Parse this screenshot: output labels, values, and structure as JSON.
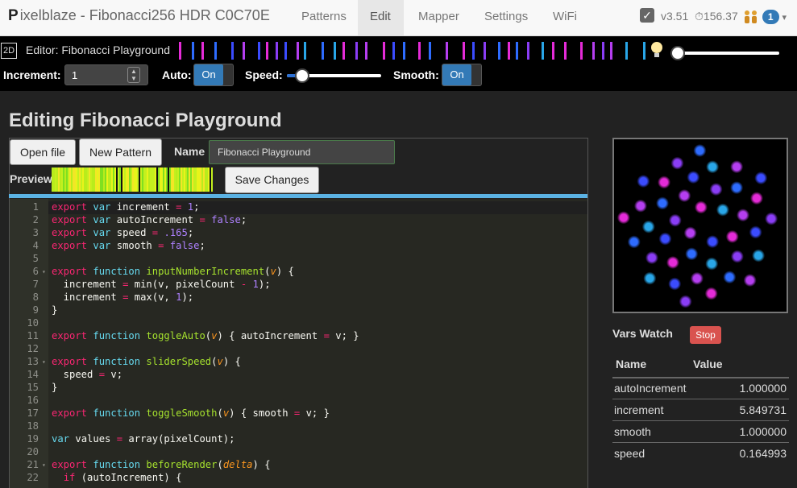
{
  "nav": {
    "brand_logo": "P",
    "brand_title": "ixelblaze - Fibonacci256 HDR C0C70E",
    "items": [
      "Patterns",
      "Edit",
      "Mapper",
      "Settings",
      "WiFi"
    ],
    "active": "Edit",
    "version": "v3.51",
    "fps": "⏱156.37",
    "connections": "1",
    "caret": "▾",
    "check": "✓"
  },
  "editor_bar": {
    "mode": "2D",
    "title": "Editor: Fibonacci Playground",
    "brightness": 0.07,
    "controls": {
      "increment_label": "Increment:",
      "increment_value": "1",
      "spin_up": "▲",
      "spin_down": "▼",
      "auto_label": "Auto:",
      "auto_state": "On",
      "speed_label": "Speed:",
      "speed_value": 0.165,
      "smooth_label": "Smooth:",
      "smooth_state": "On"
    }
  },
  "page": {
    "heading": "Editing Fibonacci Playground",
    "open_file": "Open file",
    "new_pattern": "New Pattern",
    "name_label": "Name",
    "name_value": "Fibonacci Playground",
    "preview_label": "Preview",
    "save_changes": "Save Changes"
  },
  "code": {
    "line_numbers": [
      "1",
      "2",
      "3",
      "4",
      "5",
      "6",
      "7",
      "8",
      "9",
      "10",
      "11",
      "12",
      "13",
      "14",
      "15",
      "16",
      "17",
      "18",
      "19",
      "20",
      "21",
      "22"
    ],
    "fold_marker": "▾",
    "lines": [
      [
        [
          "k",
          "export"
        ],
        [
          "t",
          " "
        ],
        [
          "s",
          "var"
        ],
        [
          "t",
          " increment "
        ],
        [
          "o",
          "="
        ],
        [
          "t",
          " "
        ],
        [
          "n",
          "1"
        ],
        [
          "t",
          ";"
        ]
      ],
      [
        [
          "k",
          "export"
        ],
        [
          "t",
          " "
        ],
        [
          "s",
          "var"
        ],
        [
          "t",
          " autoIncrement "
        ],
        [
          "o",
          "="
        ],
        [
          "t",
          " "
        ],
        [
          "n",
          "false"
        ],
        [
          "t",
          ";"
        ]
      ],
      [
        [
          "k",
          "export"
        ],
        [
          "t",
          " "
        ],
        [
          "s",
          "var"
        ],
        [
          "t",
          " speed "
        ],
        [
          "o",
          "="
        ],
        [
          "t",
          " "
        ],
        [
          "n",
          ".165"
        ],
        [
          "t",
          ";"
        ]
      ],
      [
        [
          "k",
          "export"
        ],
        [
          "t",
          " "
        ],
        [
          "s",
          "var"
        ],
        [
          "t",
          " smooth "
        ],
        [
          "o",
          "="
        ],
        [
          "t",
          " "
        ],
        [
          "n",
          "false"
        ],
        [
          "t",
          ";"
        ]
      ],
      [],
      [
        [
          "k",
          "export"
        ],
        [
          "t",
          " "
        ],
        [
          "s",
          "function"
        ],
        [
          "t",
          " "
        ],
        [
          "f",
          "inputNumberIncrement"
        ],
        [
          "t",
          "("
        ],
        [
          "p",
          "v"
        ],
        [
          "t",
          ") {"
        ]
      ],
      [
        [
          "t",
          "  increment "
        ],
        [
          "o",
          "="
        ],
        [
          "t",
          " min(v, pixelCount "
        ],
        [
          "o",
          "-"
        ],
        [
          "t",
          " "
        ],
        [
          "n",
          "1"
        ],
        [
          "t",
          ");"
        ]
      ],
      [
        [
          "t",
          "  increment "
        ],
        [
          "o",
          "="
        ],
        [
          "t",
          " max(v, "
        ],
        [
          "n",
          "1"
        ],
        [
          "t",
          ");"
        ]
      ],
      [
        [
          "t",
          "}"
        ]
      ],
      [],
      [
        [
          "k",
          "export"
        ],
        [
          "t",
          " "
        ],
        [
          "s",
          "function"
        ],
        [
          "t",
          " "
        ],
        [
          "f",
          "toggleAuto"
        ],
        [
          "t",
          "("
        ],
        [
          "p",
          "v"
        ],
        [
          "t",
          ") { autoIncrement "
        ],
        [
          "o",
          "="
        ],
        [
          "t",
          " v; }"
        ]
      ],
      [],
      [
        [
          "k",
          "export"
        ],
        [
          "t",
          " "
        ],
        [
          "s",
          "function"
        ],
        [
          "t",
          " "
        ],
        [
          "f",
          "sliderSpeed"
        ],
        [
          "t",
          "("
        ],
        [
          "p",
          "v"
        ],
        [
          "t",
          ") {"
        ]
      ],
      [
        [
          "t",
          "  speed "
        ],
        [
          "o",
          "="
        ],
        [
          "t",
          " v;"
        ]
      ],
      [
        [
          "t",
          "}"
        ]
      ],
      [],
      [
        [
          "k",
          "export"
        ],
        [
          "t",
          " "
        ],
        [
          "s",
          "function"
        ],
        [
          "t",
          " "
        ],
        [
          "f",
          "toggleSmooth"
        ],
        [
          "t",
          "("
        ],
        [
          "p",
          "v"
        ],
        [
          "t",
          ") { smooth "
        ],
        [
          "o",
          "="
        ],
        [
          "t",
          " v; }"
        ]
      ],
      [],
      [
        [
          "s",
          "var"
        ],
        [
          "t",
          " values "
        ],
        [
          "o",
          "="
        ],
        [
          "t",
          " array(pixelCount);"
        ]
      ],
      [],
      [
        [
          "k",
          "export"
        ],
        [
          "t",
          " "
        ],
        [
          "s",
          "function"
        ],
        [
          "t",
          " "
        ],
        [
          "f",
          "beforeRender"
        ],
        [
          "t",
          "("
        ],
        [
          "p",
          "delta"
        ],
        [
          "t",
          ") {"
        ]
      ],
      [
        [
          "t",
          "  "
        ],
        [
          "k",
          "if"
        ],
        [
          "t",
          " (autoIncrement) {"
        ]
      ]
    ]
  },
  "vars_watch": {
    "title": "Vars Watch",
    "stop": "Stop",
    "col_name": "Name",
    "col_value": "Value",
    "rows": [
      {
        "name": "autoIncrement",
        "value": "1.000000"
      },
      {
        "name": "increment",
        "value": "5.849731"
      },
      {
        "name": "smooth",
        "value": "1.000000"
      },
      {
        "name": "speed",
        "value": "0.164993"
      }
    ]
  },
  "colors": {
    "accent": "#337ab7",
    "stop": "#d9534f",
    "pixel_palette": [
      "#2e6cff",
      "#b53ef0",
      "#e52bd8",
      "#3b4cff",
      "#8a3df5",
      "#29a6e8"
    ],
    "preview_palette": [
      "#e8f41a",
      "#b9ec1c",
      "#7fe020",
      "#f3e626",
      "#c4f01e"
    ]
  }
}
